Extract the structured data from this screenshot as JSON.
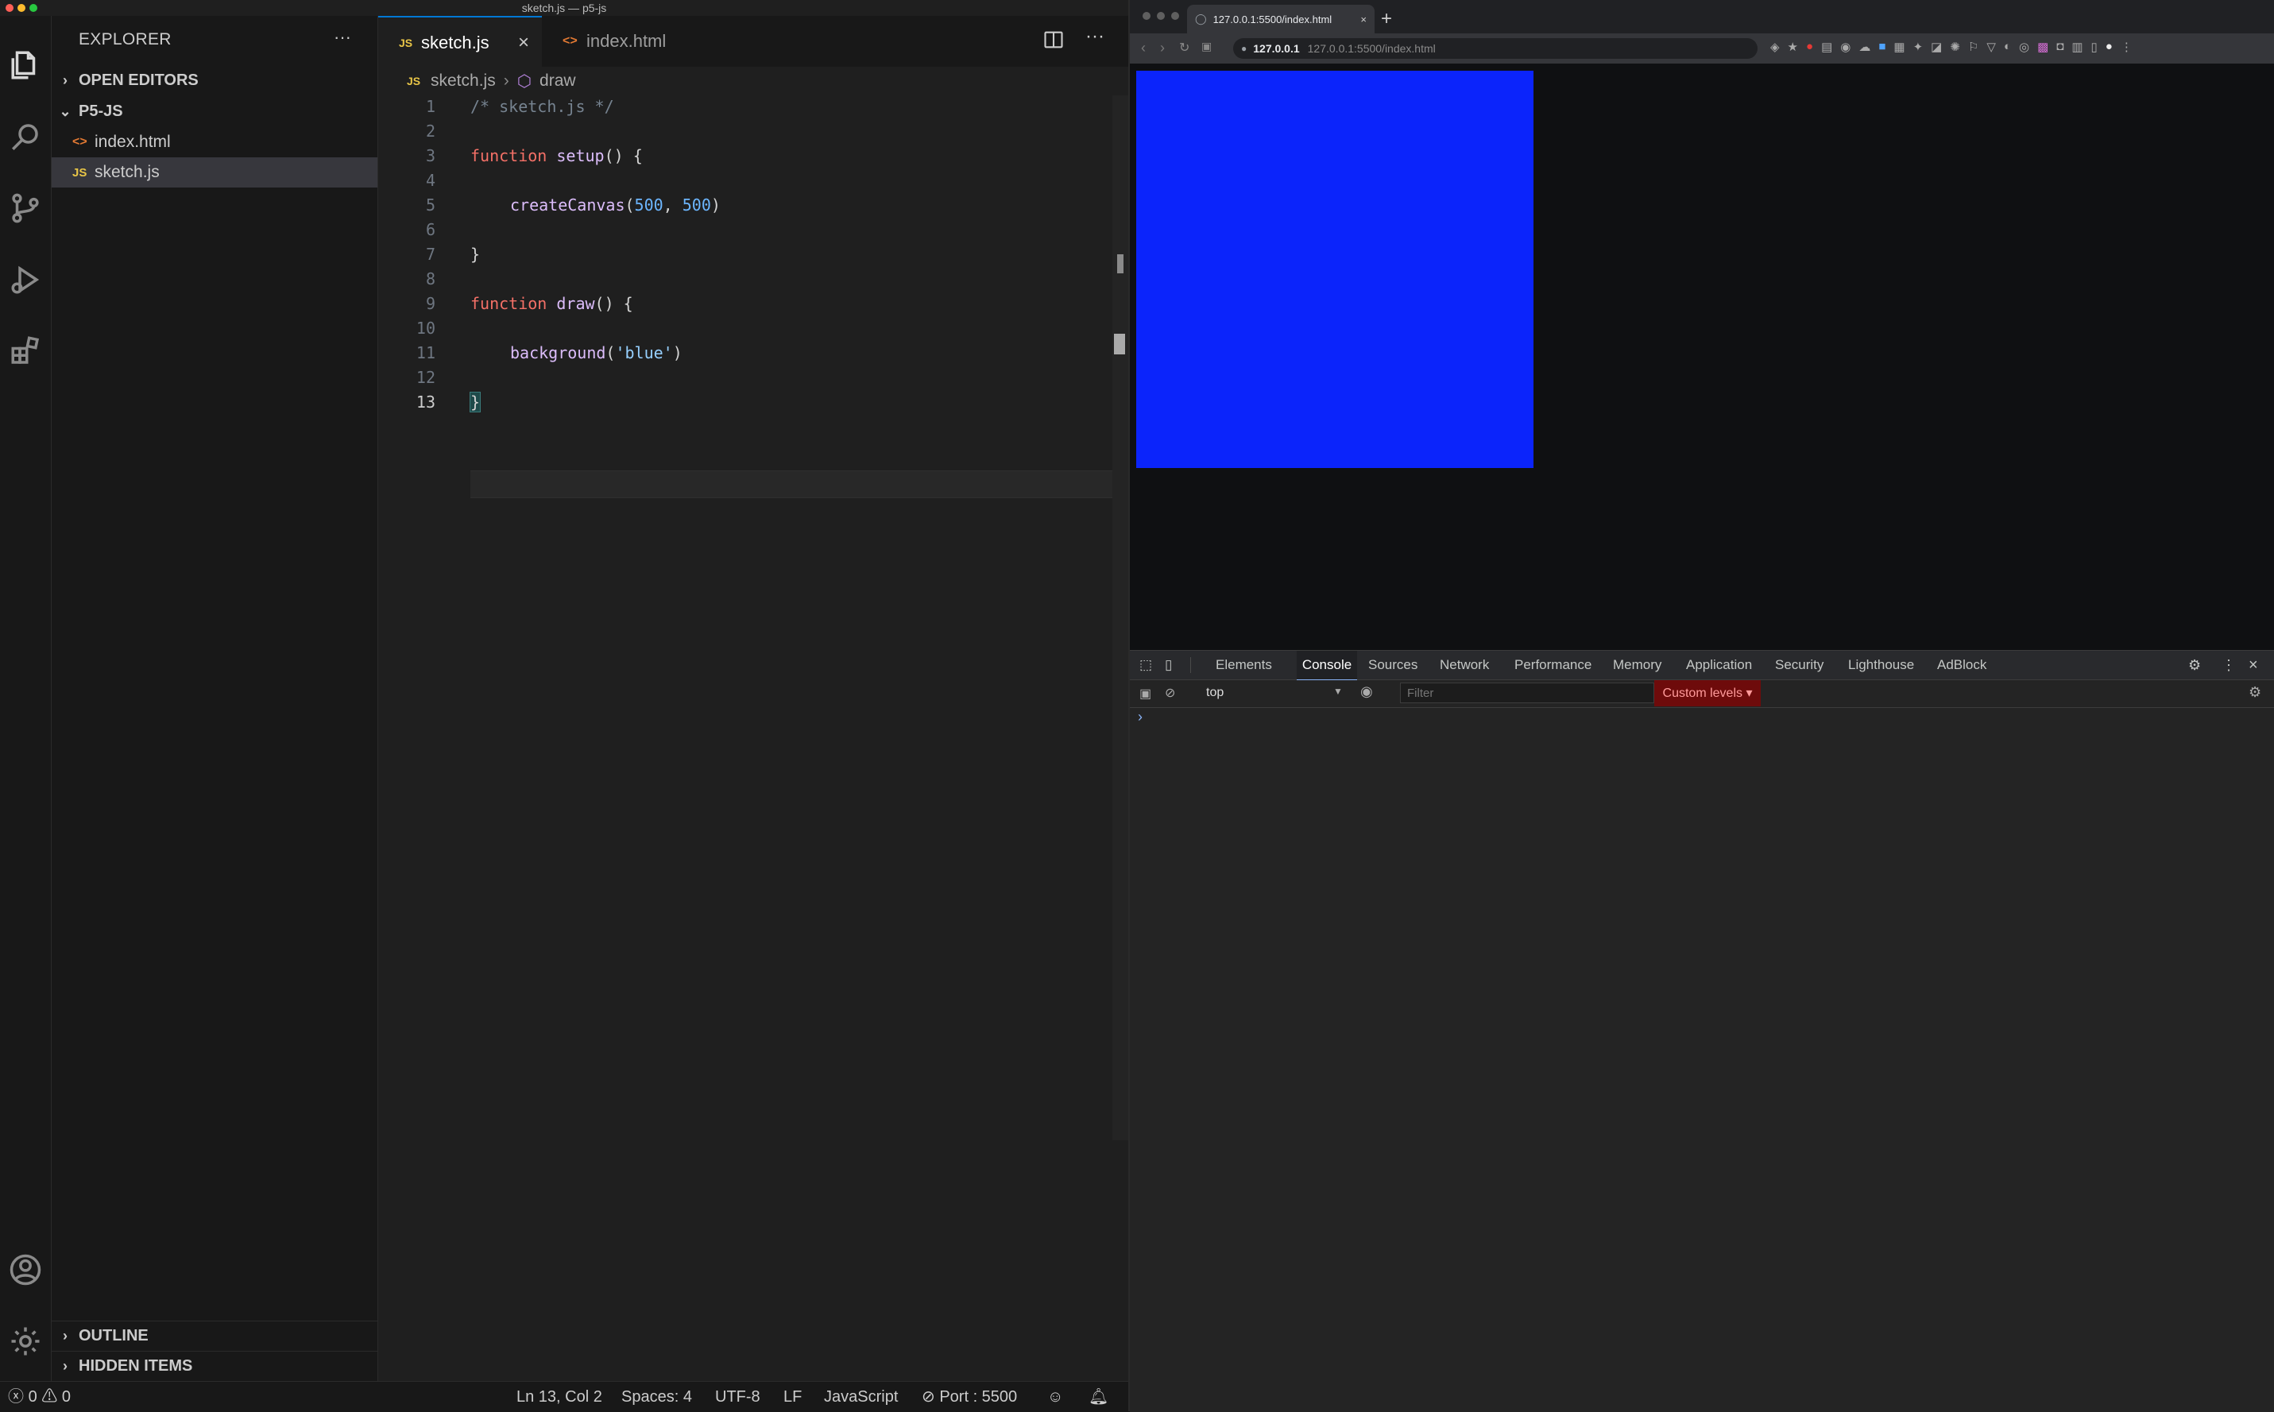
{
  "window_title": "sketch.js — p5-js",
  "sidebar": {
    "title": "EXPLORER",
    "more": "···",
    "open_editors": "OPEN EDITORS",
    "project": "P5-JS",
    "files": [
      {
        "icon": "<>",
        "name": "index.html"
      },
      {
        "icon": "JS",
        "name": "sketch.js"
      }
    ],
    "outline": "OUTLINE",
    "hidden_items": "HIDDEN ITEMS"
  },
  "tabs": [
    {
      "icon": "JS",
      "label": "sketch.js",
      "active": true
    },
    {
      "icon": "<>",
      "label": "index.html",
      "active": false
    }
  ],
  "breadcrumb": {
    "file_icon": "JS",
    "file": "sketch.js",
    "symbol": "draw"
  },
  "code": {
    "line_numbers": [
      "1",
      "2",
      "3",
      "4",
      "5",
      "6",
      "7",
      "8",
      "9",
      "10",
      "11",
      "12",
      "13"
    ],
    "l1": "/* sketch.js */",
    "l3_kw": "function",
    "l3_fn": "setup",
    "l3_rest": "() {",
    "l5_fn": "createCanvas",
    "l5_open": "(",
    "l5_a": "500",
    "l5_sep": ", ",
    "l5_b": "500",
    "l5_close": ")",
    "l7": "}",
    "l9_kw": "function",
    "l9_fn": "draw",
    "l9_rest": "() {",
    "l11_fn": "background",
    "l11_open": "(",
    "l11_str": "'blue'",
    "l11_close": ")",
    "l13": "}"
  },
  "status": {
    "errors": "0",
    "warnings": "0",
    "position": "Ln 13, Col 2",
    "spaces": "Spaces: 4",
    "encoding": "UTF-8",
    "eol": "LF",
    "language": "JavaScript",
    "port": "Port : 5500"
  },
  "browser": {
    "tab_title": "127.0.0.1:5500/index.html",
    "new_tab": "+",
    "url_host": "127.0.0.1",
    "url_rest": "127.0.0.1:5500/index.html",
    "canvas_color": "#0b24fb"
  },
  "devtools": {
    "tabs": [
      "Elements",
      "Console",
      "Sources",
      "Network",
      "Performance",
      "Memory",
      "Application",
      "Security",
      "Lighthouse",
      "AdBlock"
    ],
    "active_tab": "Console",
    "context": "top",
    "filter_placeholder": "Filter",
    "levels": "Custom levels ▾",
    "prompt": "›"
  },
  "colors": {
    "accent_blue": "#0078d4",
    "js_yellow": "#e8c547",
    "html_orange": "#e37933"
  }
}
